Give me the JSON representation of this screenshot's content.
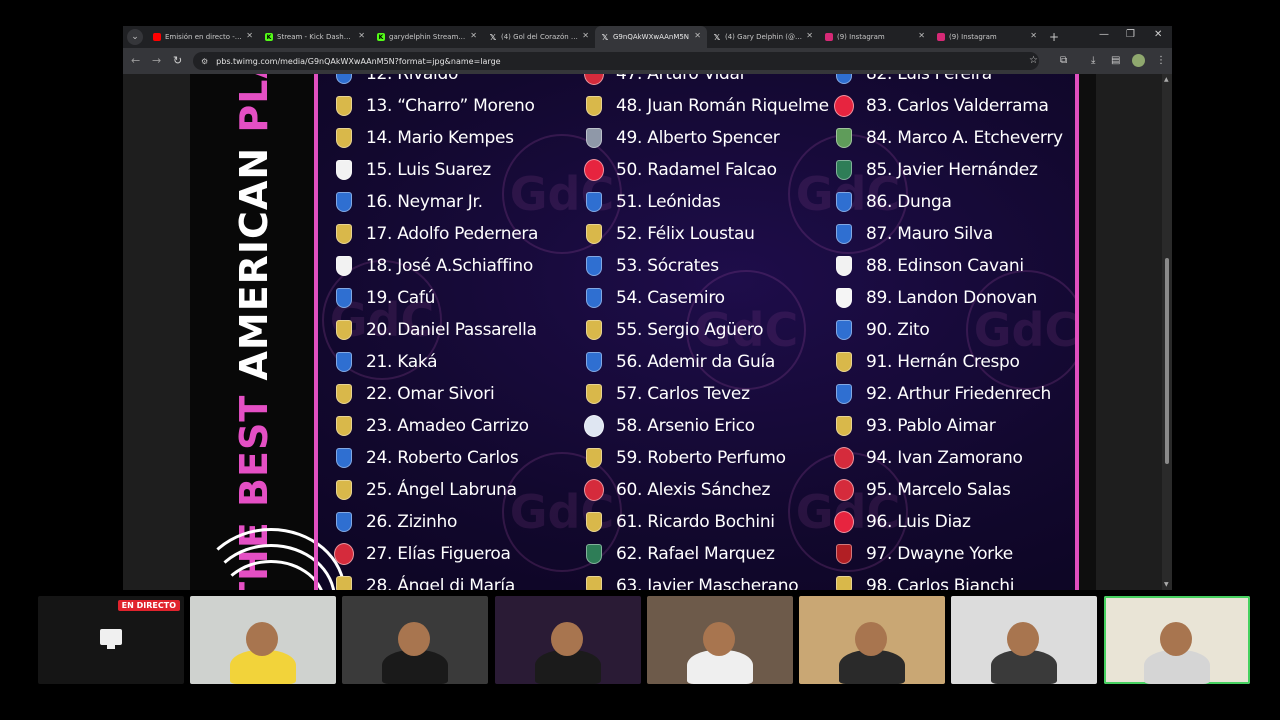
{
  "browser": {
    "tabs": [
      {
        "label": "Emisión en directo - YouTube",
        "favicon": "youtube-icon",
        "color": "#ff0000",
        "active": false
      },
      {
        "label": "Stream - Kick Dashboard",
        "favicon": "kick-icon",
        "color": "#53fc18",
        "active": false
      },
      {
        "label": "garydelphin Stream - Kick",
        "favicon": "kick-icon",
        "color": "#53fc18",
        "active": false
      },
      {
        "label": "(4) Gol del Corazón en X",
        "favicon": "x-icon",
        "color": "#000000",
        "active": false
      },
      {
        "label": "G9nQAkWXwAAnM5N",
        "favicon": "x-icon",
        "color": "#000000",
        "active": true
      },
      {
        "label": "(4) Gary Delphin (@gary",
        "favicon": "x-icon",
        "color": "#000000",
        "active": false
      },
      {
        "label": "(9) Instagram",
        "favicon": "instagram-icon",
        "color": "#d62976",
        "active": false
      },
      {
        "label": "(9) Instagram",
        "favicon": "instagram-icon",
        "color": "#d62976",
        "active": false
      }
    ],
    "url": "pbs.twimg.com/media/G9nQAkWXwAAnM5N?format=jpg&name=large"
  },
  "poster": {
    "vertical_title": {
      "part1": "THE BEST ",
      "part2": "AMERICAN ",
      "part3": "PLA"
    },
    "watermark": "GdC",
    "columns": [
      [
        {
          "text": "12. Rivaldo",
          "crest": "brazil",
          "partial": true
        },
        {
          "text": "13. “Charro” Moreno",
          "crest": "argentina"
        },
        {
          "text": "14. Mario Kempes",
          "crest": "argentina"
        },
        {
          "text": "15. Luis Suarez",
          "crest": "uruguay"
        },
        {
          "text": "16. Neymar Jr.",
          "crest": "brazil"
        },
        {
          "text": "17. Adolfo Pedernera",
          "crest": "argentina"
        },
        {
          "text": "18. José A.Schiaffino",
          "crest": "uruguay"
        },
        {
          "text": "19. Cafú",
          "crest": "brazil"
        },
        {
          "text": "20. Daniel Passarella",
          "crest": "argentina"
        },
        {
          "text": "21. Kaká",
          "crest": "brazil"
        },
        {
          "text": "22. Omar Sivori",
          "crest": "argentina"
        },
        {
          "text": "23. Amadeo Carrizo",
          "crest": "argentina"
        },
        {
          "text": "24. Roberto Carlos",
          "crest": "brazil"
        },
        {
          "text": "25. Ángel Labruna",
          "crest": "argentina"
        },
        {
          "text": "26. Zizinho",
          "crest": "brazil"
        },
        {
          "text": "27. Elías Figueroa",
          "crest": "chile"
        },
        {
          "text": "28. Ángel di María",
          "crest": "argentina",
          "partial": true
        }
      ],
      [
        {
          "text": "47. Arturo Vidal",
          "crest": "chile",
          "partial": true
        },
        {
          "text": "48. Juan Román Riquelme",
          "crest": "argentina"
        },
        {
          "text": "49. Alberto Spencer",
          "crest": "ecuador"
        },
        {
          "text": "50. Radamel Falcao",
          "crest": "colombia"
        },
        {
          "text": "51. Leónidas",
          "crest": "brazil"
        },
        {
          "text": "52. Félix Loustau",
          "crest": "argentina"
        },
        {
          "text": "53. Sócrates",
          "crest": "brazil"
        },
        {
          "text": "54. Casemiro",
          "crest": "brazil"
        },
        {
          "text": "55. Sergio Agüero",
          "crest": "argentina"
        },
        {
          "text": "56. Ademir da Guía",
          "crest": "brazil"
        },
        {
          "text": "57. Carlos Tevez",
          "crest": "argentina"
        },
        {
          "text": "58. Arsenio Erico",
          "crest": "paraguay"
        },
        {
          "text": "59. Roberto Perfumo",
          "crest": "argentina"
        },
        {
          "text": "60. Alexis Sánchez",
          "crest": "chile"
        },
        {
          "text": "61. Ricardo Bochini",
          "crest": "argentina"
        },
        {
          "text": "62. Rafael Marquez",
          "crest": "mexico"
        },
        {
          "text": "63. Javier Mascherano",
          "crest": "argentina",
          "partial": true
        }
      ],
      [
        {
          "text": "82. Luis Pereira",
          "crest": "brazil",
          "partial": true
        },
        {
          "text": "83. Carlos Valderrama",
          "crest": "colombia"
        },
        {
          "text": "84. Marco A. Etcheverry",
          "crest": "bolivia"
        },
        {
          "text": "85. Javier Hernández",
          "crest": "mexico"
        },
        {
          "text": "86. Dunga",
          "crest": "brazil"
        },
        {
          "text": "87. Mauro Silva",
          "crest": "brazil"
        },
        {
          "text": "88. Edinson Cavani",
          "crest": "uruguay"
        },
        {
          "text": "89. Landon Donovan",
          "crest": "usa"
        },
        {
          "text": "90. Zito",
          "crest": "brazil"
        },
        {
          "text": "91. Hernán Crespo",
          "crest": "argentina"
        },
        {
          "text": "92. Arthur Friedenrech",
          "crest": "brazil"
        },
        {
          "text": "93. Pablo Aimar",
          "crest": "argentina"
        },
        {
          "text": "94. Ivan Zamorano",
          "crest": "chile"
        },
        {
          "text": "95. Marcelo Salas",
          "crest": "chile"
        },
        {
          "text": "96. Luis Diaz",
          "crest": "colombia"
        },
        {
          "text": "97. Dwayne Yorke",
          "crest": "trinidad"
        },
        {
          "text": "98. Carlos Bianchi",
          "crest": "argentina",
          "partial": true
        }
      ]
    ]
  },
  "crest_colors": {
    "argentina": "#d9b84a",
    "brazil": "#2f6fd1",
    "uruguay": "#f2f2f2",
    "chile": "#d52b3c",
    "colombia": "#e7243f",
    "ecuador": "#8f98a8",
    "paraguay": "#dfe6f2",
    "mexico": "#2e7d57",
    "bolivia": "#5f9c5a",
    "usa": "#f5f5f5",
    "trinidad": "#b11f24"
  },
  "stream": {
    "live_label": "EN DIRECTO",
    "cams": [
      {
        "id": "screen-share",
        "bg": "#151515"
      },
      {
        "id": "cam-1",
        "bg": "#cfd2cf"
      },
      {
        "id": "cam-2",
        "bg": "#3a3a3a"
      },
      {
        "id": "cam-3",
        "bg": "#2a1b35"
      },
      {
        "id": "cam-4",
        "bg": "#6d5a4a"
      },
      {
        "id": "cam-5",
        "bg": "#c9a774"
      },
      {
        "id": "cam-6",
        "bg": "#dcdcdc"
      },
      {
        "id": "cam-7",
        "bg": "#e9e4d6"
      }
    ]
  }
}
